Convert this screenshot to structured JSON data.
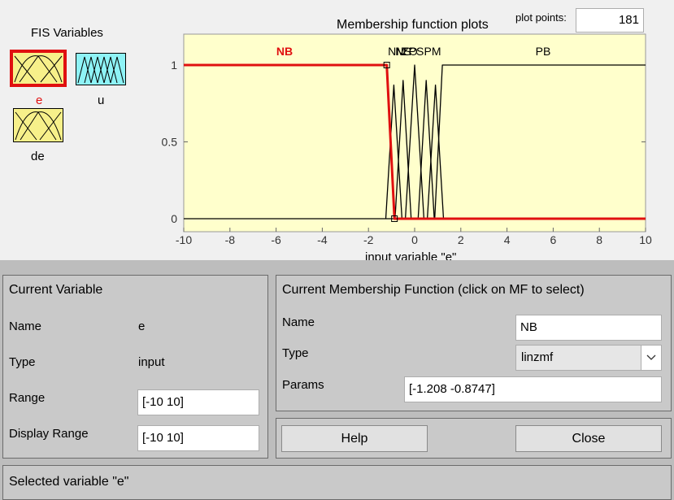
{
  "fis": {
    "title": "FIS Variables",
    "variables": [
      {
        "name": "e",
        "color": "#f7f08a",
        "selected": true
      },
      {
        "name": "u",
        "color": "#8ef3f6",
        "selected": false
      },
      {
        "name": "de",
        "color": "#f7f08a",
        "selected": false
      }
    ]
  },
  "plot": {
    "title": "Membership function plots",
    "plot_points_label": "plot points:",
    "plot_points_value": "181",
    "xlabel": "input variable \"e\"",
    "x_ticks": [
      "-10",
      "-8",
      "-6",
      "-4",
      "-2",
      "0",
      "2",
      "4",
      "6",
      "8",
      "10"
    ],
    "y_ticks": [
      "0",
      "0.5",
      "1"
    ],
    "mf_labels": [
      "NB",
      "NM",
      "NS",
      "ZO",
      "PS",
      "PM",
      "PB"
    ],
    "selected_mf": "NB",
    "background": "#ffffcc",
    "selected_color": "#e01010"
  },
  "chart_data": {
    "type": "line",
    "xlim": [
      -10,
      10
    ],
    "ylim": [
      0,
      1
    ],
    "xlabel": "input variable \"e\"",
    "series": [
      {
        "name": "NB",
        "x": [
          -10,
          -1.208,
          -0.8747,
          10
        ],
        "y": [
          1,
          1,
          0,
          0
        ]
      },
      {
        "name": "NM",
        "x": [
          -1.25,
          -0.9,
          -0.55
        ],
        "y": [
          0,
          0.87,
          0
        ]
      },
      {
        "name": "NS",
        "x": [
          -0.85,
          -0.5,
          -0.15
        ],
        "y": [
          0,
          0.9,
          0
        ]
      },
      {
        "name": "ZO",
        "x": [
          -0.4,
          0,
          0.4
        ],
        "y": [
          0,
          1,
          0
        ]
      },
      {
        "name": "PS",
        "x": [
          0.15,
          0.5,
          0.85
        ],
        "y": [
          0,
          0.9,
          0
        ]
      },
      {
        "name": "PM",
        "x": [
          0.55,
          0.9,
          1.25
        ],
        "y": [
          0,
          0.87,
          0
        ]
      },
      {
        "name": "PB",
        "x": [
          -10,
          0.87,
          1.2,
          10
        ],
        "y": [
          0,
          0,
          1,
          1
        ]
      }
    ]
  },
  "current_variable": {
    "title": "Current Variable",
    "name_label": "Name",
    "name_value": "e",
    "type_label": "Type",
    "type_value": "input",
    "range_label": "Range",
    "range_value": "[-10 10]",
    "display_range_label": "Display Range",
    "display_range_value": "[-10 10]"
  },
  "current_mf": {
    "title": "Current Membership Function (click on MF to select)",
    "name_label": "Name",
    "name_value": "NB",
    "type_label": "Type",
    "type_value": "linzmf",
    "params_label": "Params",
    "params_value": "[-1.208 -0.8747]"
  },
  "buttons": {
    "help": "Help",
    "close": "Close"
  },
  "status": {
    "text": "Selected variable \"e\""
  }
}
